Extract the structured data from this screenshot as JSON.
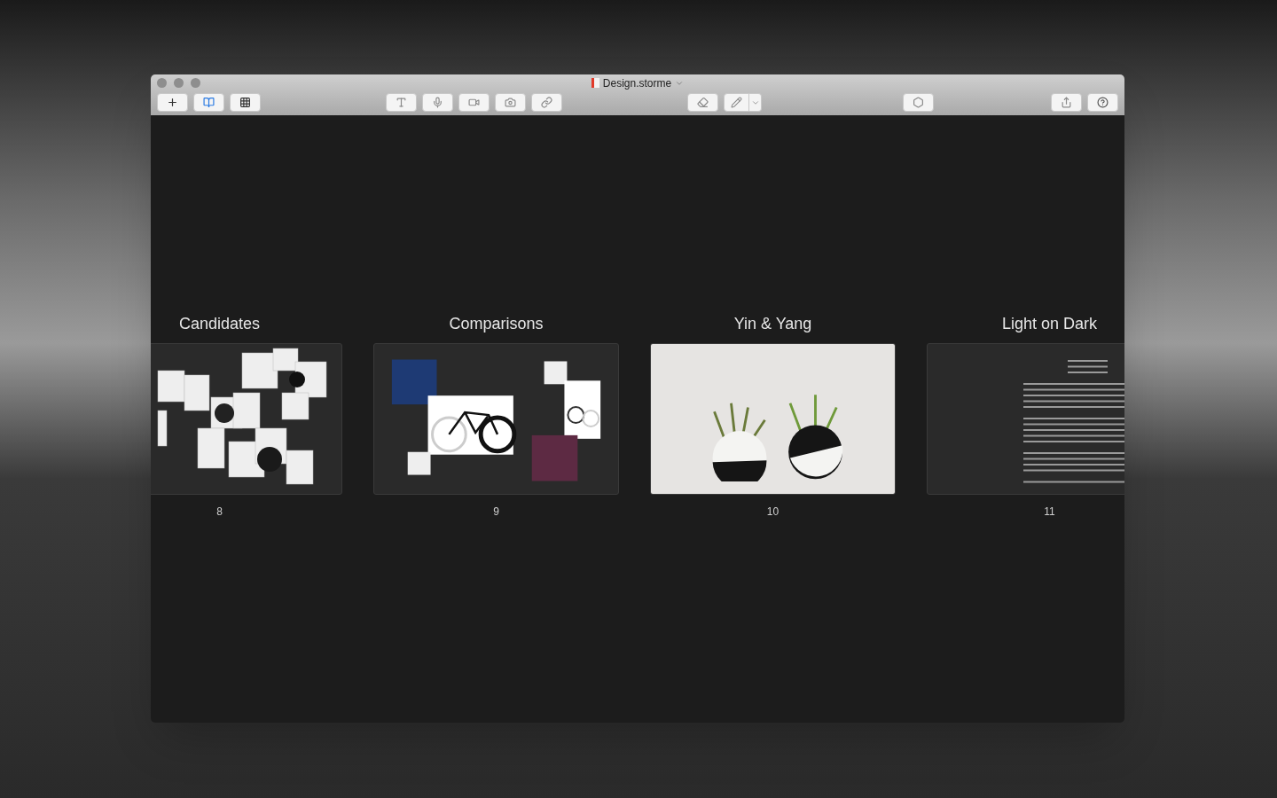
{
  "window": {
    "title": "Design.storme"
  },
  "view_buttons": [
    {
      "selected": false
    },
    {
      "selected": true
    },
    {
      "selected": false
    }
  ],
  "slides": [
    {
      "title": "Candidates",
      "number": "8",
      "kind": "collage"
    },
    {
      "title": "Comparisons",
      "number": "9",
      "kind": "notes"
    },
    {
      "title": "Yin & Yang",
      "number": "10",
      "kind": "photo"
    },
    {
      "title": "Light on Dark",
      "number": "11",
      "kind": "text"
    }
  ]
}
